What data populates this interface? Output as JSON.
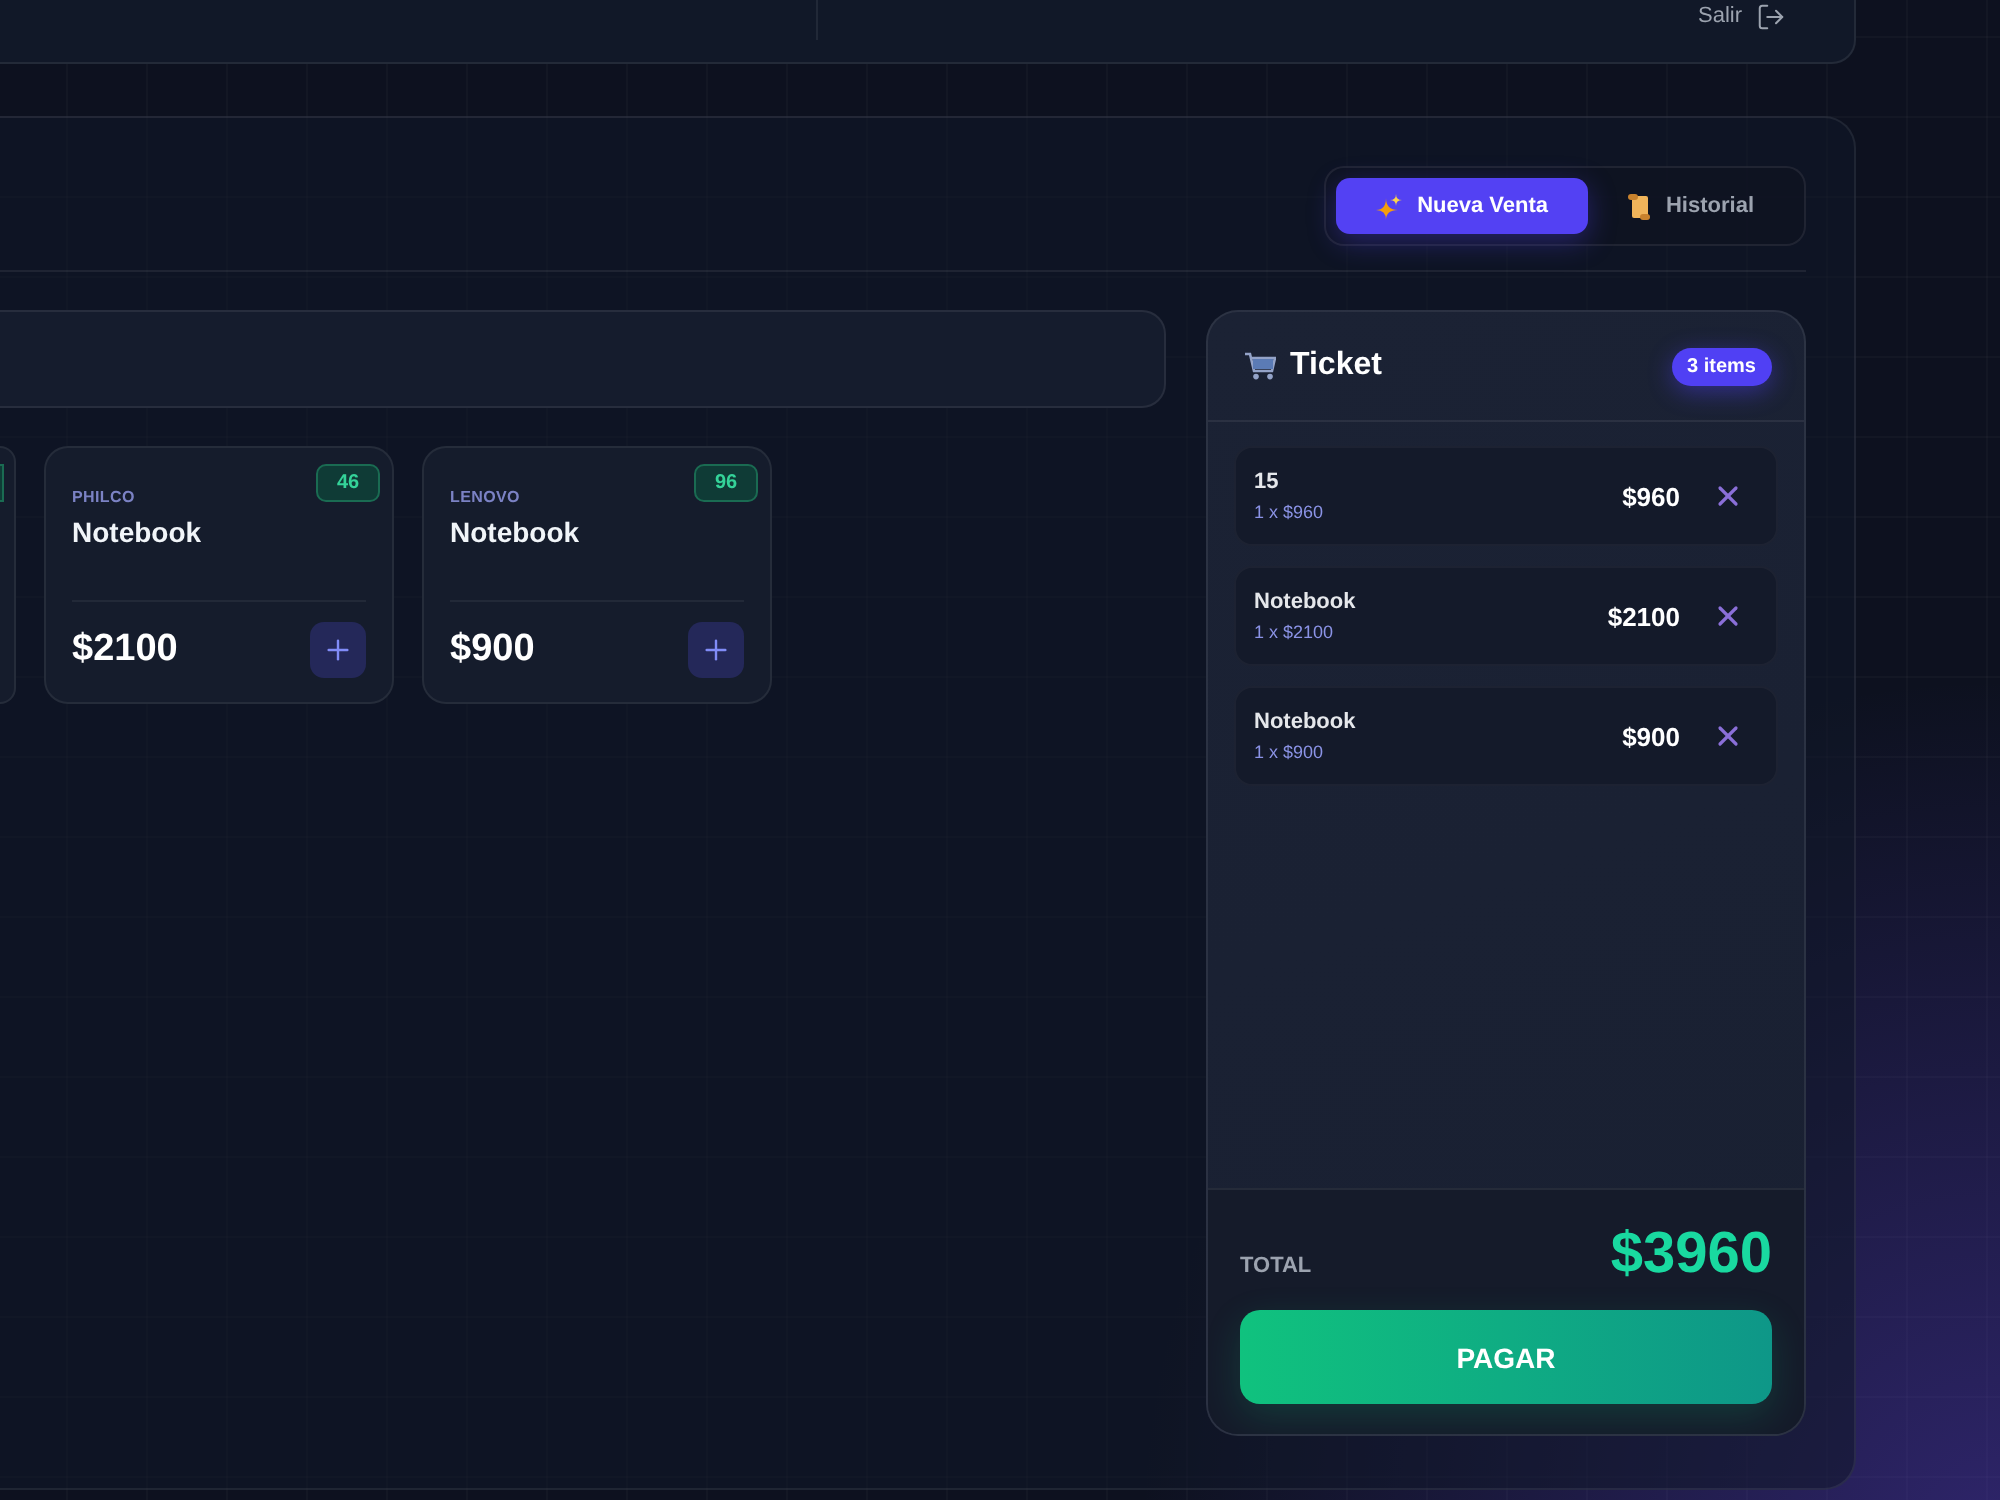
{
  "top_bar": {
    "logout_label": "Salir"
  },
  "tabs": [
    {
      "label": "Nueva Venta",
      "selected": true
    },
    {
      "label": "Historial",
      "selected": false
    }
  ],
  "products": [
    {
      "kind": "clipped"
    },
    {
      "kind": "card",
      "brand": "PHILCO",
      "name": "Notebook",
      "stock": "46",
      "price": "$2100"
    },
    {
      "kind": "card",
      "brand": "LENOVO",
      "name": "Notebook",
      "stock": "96",
      "price": "$900"
    }
  ],
  "ticket": {
    "title": "Ticket",
    "count": "3 items",
    "items": [
      {
        "name": "15",
        "detail": "1 x $960",
        "amount": "$960"
      },
      {
        "name": "Notebook",
        "detail": "1 x $2100",
        "amount": "$2100"
      },
      {
        "name": "Notebook",
        "detail": "1 x $900",
        "amount": "$900"
      }
    ],
    "total_label": "TOTAL",
    "total": "$3960",
    "pay_label": "PAGAR"
  }
}
